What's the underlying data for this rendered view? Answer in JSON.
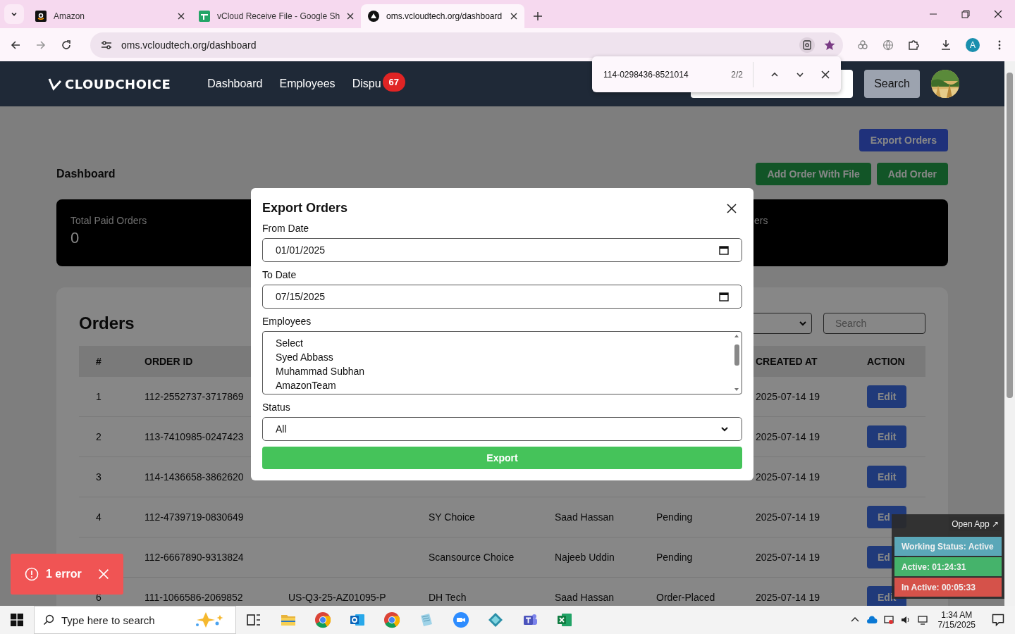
{
  "browser": {
    "tabs": [
      {
        "title": "Amazon",
        "kind": "amazon",
        "selected": false
      },
      {
        "title": "vCloud Receive File - Google Sh",
        "kind": "sheets",
        "selected": false
      },
      {
        "title": "oms.vcloudtech.org/dashboard",
        "kind": "site",
        "selected": true
      }
    ],
    "address": "oms.vcloudtech.org/dashboard",
    "profile": "A"
  },
  "find_bar": {
    "query": "114-0298436-8521014",
    "count": "2/2"
  },
  "navbar": {
    "logo": "CLOUDCHOICE",
    "links": [
      "Dashboard",
      "Employees",
      "Dispu"
    ],
    "badge": "67",
    "search_button": "Search"
  },
  "dashboard": {
    "title": "Dashboard",
    "export_button": "Export Orders",
    "add_buttons": [
      "Add Order With File",
      "Add Order"
    ],
    "stats": [
      {
        "label": "Total Paid Orders",
        "value": "0"
      },
      {
        "label": "ers"
      }
    ]
  },
  "orders": {
    "title": "Orders",
    "search_placeholder": "Search",
    "columns": [
      "#",
      "ORDER ID",
      "CREATED AT",
      "ACTION"
    ],
    "rows": [
      {
        "number": "1",
        "order_id": "112-2552737-3717869",
        "created_at": "2025-07-14 19",
        "action": "Edit"
      },
      {
        "number": "2",
        "order_id": "113-7410985-0247423",
        "created_at": "2025-07-14 19",
        "action": "Edit"
      },
      {
        "number": "3",
        "order_id": "114-1436658-3862620",
        "created_at": "2025-07-14 19",
        "action": "Edit"
      },
      {
        "number": "4",
        "order_id": "112-4739719-0830649",
        "column_4": "SY Choice",
        "column_5": "Saad Hassan",
        "column_6": "Pending",
        "created_at": "2025-07-14 19",
        "action": "Ed"
      },
      {
        "order_id": "112-6667890-9313824",
        "column_4": "Scansource Choice",
        "column_5": "Najeeb Uddin",
        "column_6": "Pending",
        "created_at": "2025-07-14 19",
        "action": "Ed"
      },
      {
        "number": "6",
        "order_id": "111-1066586-2069852",
        "column_3": "US-Q3-25-AZ01095-P",
        "column_4": "DH Tech",
        "column_5": "Saad Hassan",
        "column_6": "Order-Placed",
        "created_at": "2025-07-14 19",
        "action": "Edit"
      }
    ]
  },
  "modal": {
    "title": "Export Orders",
    "fields": [
      {
        "label": "From Date",
        "kind": "date",
        "value": "01/01/2025"
      },
      {
        "label": "To Date",
        "kind": "date",
        "value": "07/15/2025"
      },
      {
        "label": "Employees",
        "kind": "listbox",
        "options": [
          "Select",
          "Syed Abbass",
          "Muhammad Subhan",
          "AmazonTeam"
        ]
      },
      {
        "label": "Status",
        "kind": "select",
        "value": "All"
      }
    ],
    "button": "Export"
  },
  "toast": {
    "message": "1 error"
  },
  "widget": {
    "link": "Open App ↗",
    "statuses": [
      {
        "text": "Working Status: Active",
        "color": "#5ba7b8"
      },
      {
        "text": "Active: 01:24:31",
        "color": "#45b36b"
      },
      {
        "text": "In Active: 00:05:33",
        "color": "#d5524a"
      }
    ]
  },
  "taskbar": {
    "search_placeholder": "Type here to search",
    "apps": [
      {
        "kind": "taskview"
      },
      {
        "kind": "folder"
      },
      {
        "kind": "chrome"
      },
      {
        "kind": "outlook"
      },
      {
        "kind": "chrome"
      },
      {
        "kind": "notepad"
      },
      {
        "kind": "zoom"
      },
      {
        "kind": "diamond"
      },
      {
        "kind": "teams"
      },
      {
        "kind": "excel"
      }
    ],
    "time": "1:34 AM",
    "date": "7/15/2025"
  }
}
